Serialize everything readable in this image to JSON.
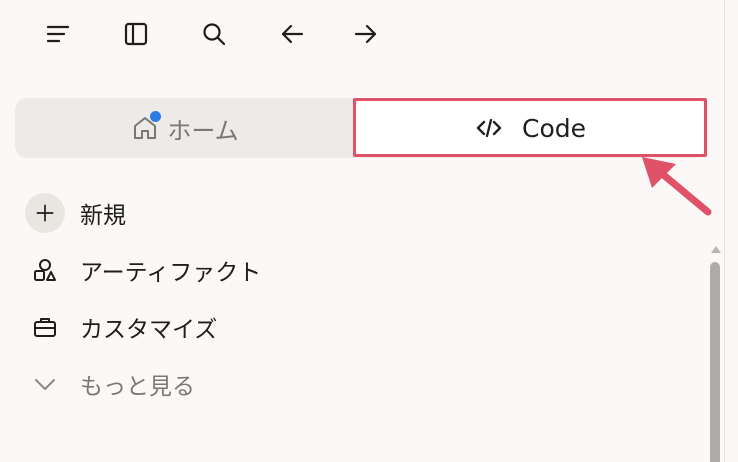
{
  "toolbar": {
    "icons": [
      "menu-icon",
      "sidebar-panel-icon",
      "search-icon",
      "back-arrow-icon",
      "forward-arrow-icon"
    ]
  },
  "segmented": {
    "home_label": "ホーム",
    "code_label": "Code",
    "home_badge_color": "#2c7be5"
  },
  "nav": {
    "new_label": "新規",
    "artifacts_label": "アーティファクト",
    "customize_label": "カスタマイズ",
    "more_label": "もっと見る"
  },
  "colors": {
    "highlight": "#e05268",
    "background": "#faf9f7"
  }
}
